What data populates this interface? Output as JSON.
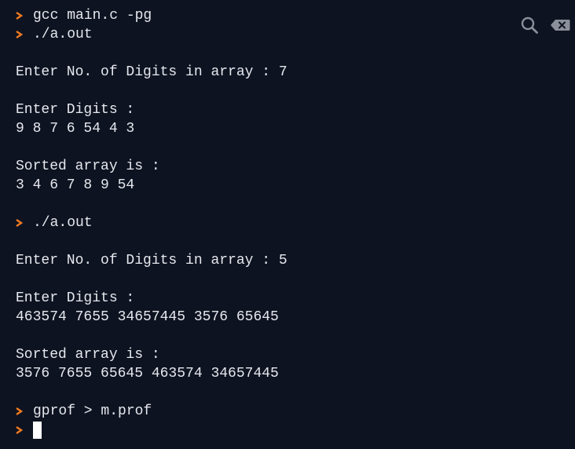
{
  "colors": {
    "background": "#0e1321",
    "text": "#e6e8ee",
    "prompt": "#f07b1f",
    "icon": "#8a8f99"
  },
  "icons": {
    "prompt": "chevron-right-icon",
    "search": "search-icon",
    "clear": "backspace-icon"
  },
  "terminal": {
    "lines": [
      {
        "type": "command",
        "text": "gcc main.c -pg"
      },
      {
        "type": "command",
        "text": "./a.out"
      },
      {
        "type": "blank",
        "text": ""
      },
      {
        "type": "output",
        "text": "Enter No. of Digits in array : 7"
      },
      {
        "type": "blank",
        "text": ""
      },
      {
        "type": "output",
        "text": "Enter Digits :"
      },
      {
        "type": "output",
        "text": "9 8 7 6 54 4 3"
      },
      {
        "type": "blank",
        "text": ""
      },
      {
        "type": "output",
        "text": "Sorted array is :"
      },
      {
        "type": "output",
        "text": "3 4 6 7 8 9 54"
      },
      {
        "type": "blank",
        "text": ""
      },
      {
        "type": "command",
        "text": "./a.out"
      },
      {
        "type": "blank",
        "text": ""
      },
      {
        "type": "output",
        "text": "Enter No. of Digits in array : 5"
      },
      {
        "type": "blank",
        "text": ""
      },
      {
        "type": "output",
        "text": "Enter Digits :"
      },
      {
        "type": "output",
        "text": "463574 7655 34657445 3576 65645"
      },
      {
        "type": "blank",
        "text": ""
      },
      {
        "type": "output",
        "text": "Sorted array is :"
      },
      {
        "type": "output",
        "text": "3576 7655 65645 463574 34657445"
      },
      {
        "type": "blank",
        "text": ""
      },
      {
        "type": "command",
        "text": "gprof > m.prof"
      },
      {
        "type": "input",
        "text": ""
      }
    ]
  }
}
